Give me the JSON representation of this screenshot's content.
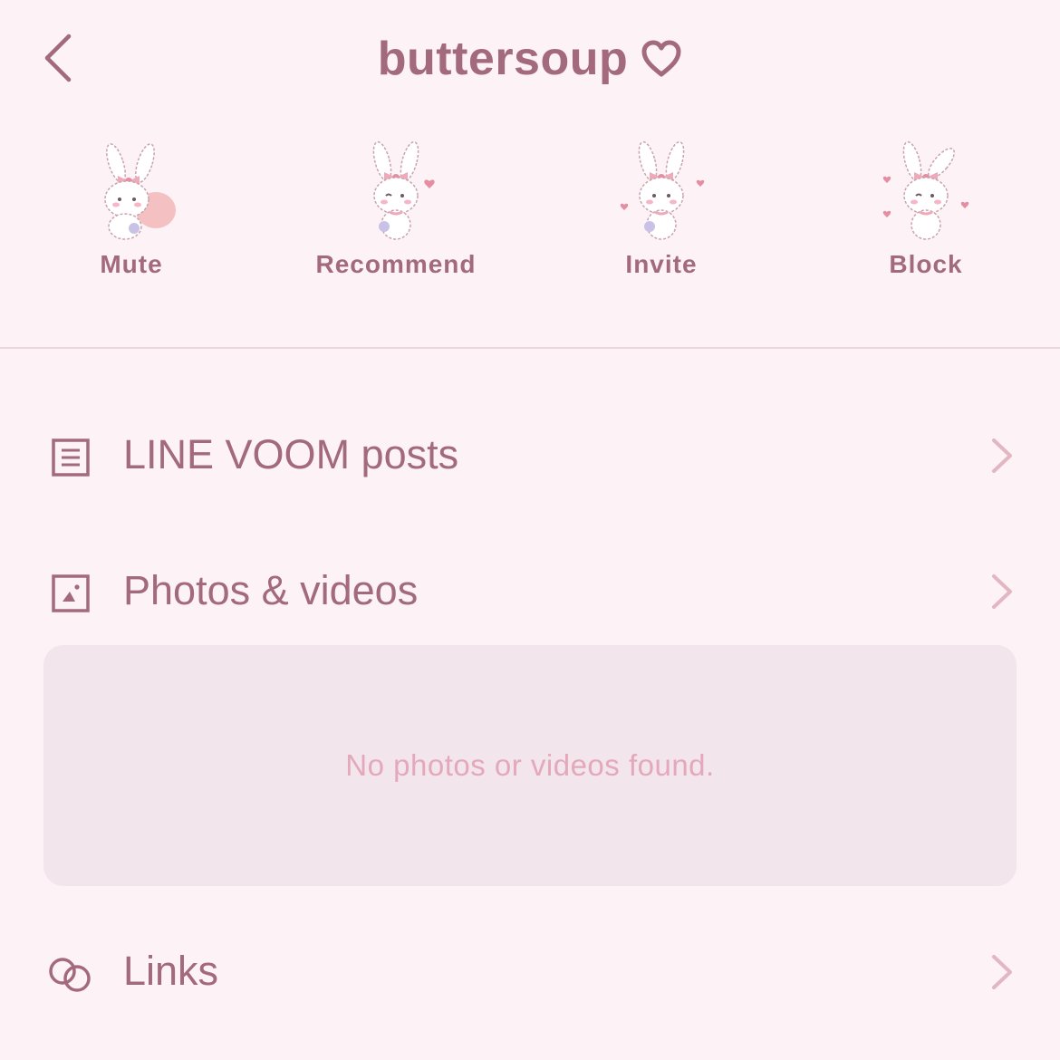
{
  "header": {
    "back_icon": "chevron-left-icon",
    "title": "buttersoup",
    "title_icon": "heart-outline-icon"
  },
  "actions": [
    {
      "label": "Mute",
      "icon": "bunny-sticker-mute"
    },
    {
      "label": "Recommend",
      "icon": "bunny-sticker-recommend"
    },
    {
      "label": "Invite",
      "icon": "bunny-sticker-invite"
    },
    {
      "label": "Block",
      "icon": "bunny-sticker-block"
    }
  ],
  "sections": {
    "voom": {
      "label": "LINE VOOM posts",
      "icon": "document-icon"
    },
    "photos": {
      "label": "Photos & videos",
      "icon": "image-icon",
      "empty_text": "No photos or videos found."
    },
    "links": {
      "label": "Links",
      "icon": "link-icon"
    }
  },
  "colors": {
    "background": "#fdf3f6",
    "text": "#a26a7c",
    "empty_text": "#e3a9ba",
    "empty_box": "#f3e5ec",
    "chevron": "#e2b6c3"
  }
}
